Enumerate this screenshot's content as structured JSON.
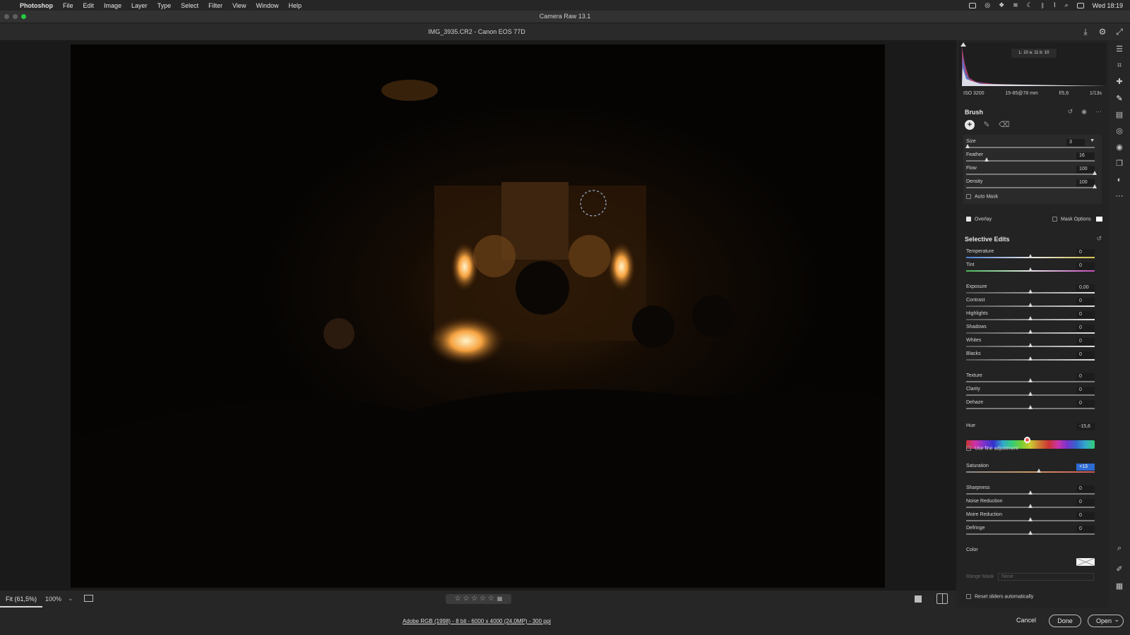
{
  "menubar": {
    "app": "Photoshop",
    "items": [
      "File",
      "Edit",
      "Image",
      "Layer",
      "Type",
      "Select",
      "Filter",
      "View",
      "Window",
      "Help"
    ],
    "clock": "Wed 18:19"
  },
  "window": {
    "title": "Camera Raw 13.1"
  },
  "file": {
    "name": "IMG_3935.CR2  -  Canon EOS 77D"
  },
  "histogram": {
    "lab_readout": "L: 10   a: 11   b: 10"
  },
  "camera_info": {
    "iso": "ISO 3200",
    "lens": "15-85@78 mm",
    "aperture": "f/5,6",
    "shutter": "1/13s"
  },
  "brush": {
    "title": "Brush",
    "size": {
      "label": "Size",
      "value": "3",
      "fraction": 0.01
    },
    "feather": {
      "label": "Feather",
      "value": "16",
      "fraction": 0.16
    },
    "flow": {
      "label": "Flow",
      "value": "100",
      "fraction": 1.0
    },
    "density": {
      "label": "Density",
      "value": "100",
      "fraction": 1.0
    },
    "auto_mask": "Auto Mask",
    "overlay": "Overlay",
    "mask_options": "Mask Options"
  },
  "selective_edits": {
    "title": "Selective Edits",
    "temp_tint": [
      {
        "label": "Temperature",
        "value": "0"
      },
      {
        "label": "Tint",
        "value": "0"
      }
    ],
    "tone": [
      {
        "label": "Exposure",
        "value": "0,00"
      },
      {
        "label": "Contrast",
        "value": "0"
      },
      {
        "label": "Highlights",
        "value": "0"
      },
      {
        "label": "Shadows",
        "value": "0"
      },
      {
        "label": "Whites",
        "value": "0"
      },
      {
        "label": "Blacks",
        "value": "0"
      }
    ],
    "presence": [
      {
        "label": "Texture",
        "value": "0"
      },
      {
        "label": "Clarity",
        "value": "0"
      },
      {
        "label": "Dehaze",
        "value": "0"
      }
    ],
    "hue": {
      "label": "Hue",
      "value": "-15,6"
    },
    "fine_adjust": "Use fine adjustment",
    "saturation": {
      "label": "Saturation",
      "value": "+13"
    },
    "detail": [
      {
        "label": "Sharpness",
        "value": "0"
      },
      {
        "label": "Noise Reduction",
        "value": "0"
      },
      {
        "label": "Moire Reduction",
        "value": "0"
      },
      {
        "label": "Defringe",
        "value": "0"
      }
    ],
    "color": "Color",
    "range_mask": "Range Mask",
    "range_mask_value": "None",
    "reset_auto": "Reset sliders automatically"
  },
  "bottom": {
    "fit": "Fit (61,5%)",
    "zoom": "100%",
    "rating_stars": "☆ ☆ ☆ ☆ ☆",
    "trash": "🗑"
  },
  "footer": {
    "info": "Adobe RGB (1998) - 8 bit - 6000 x 4000 (24,0MP) - 300 ppi",
    "cancel": "Cancel",
    "done": "Done",
    "open": "Open"
  },
  "colors": {
    "accent": "#2d6bd1",
    "bg": "#1e1e1e",
    "panel": "#232323"
  }
}
